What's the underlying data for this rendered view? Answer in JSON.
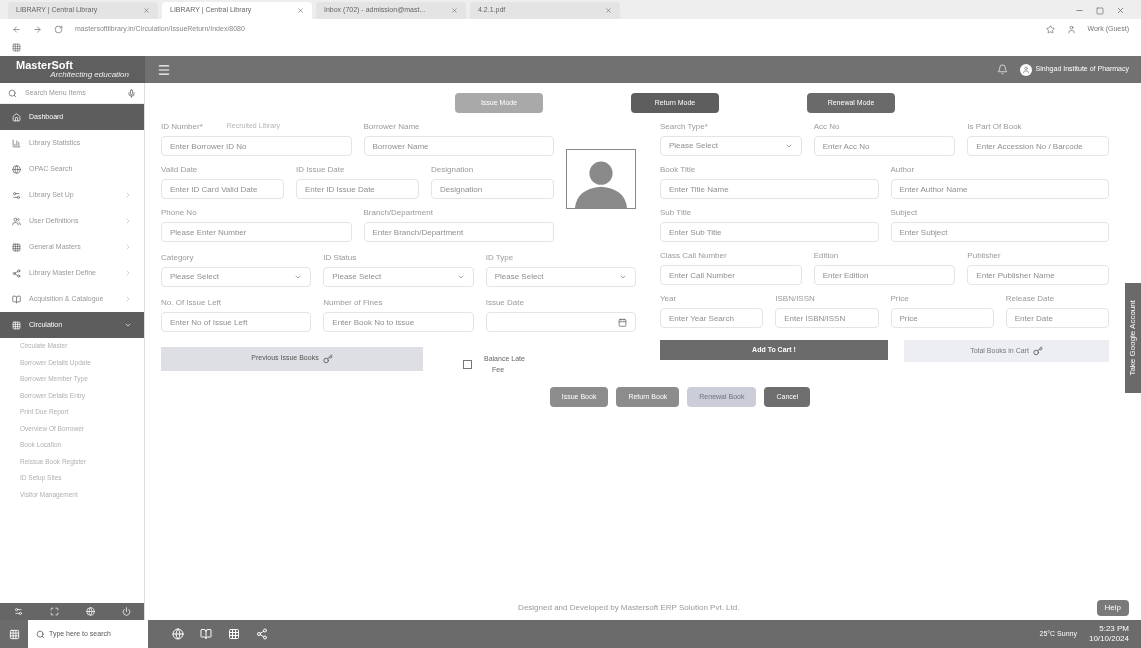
{
  "browser": {
    "tabs": [
      {
        "title": "LIBRARY | Central Library",
        "selected": false
      },
      {
        "title": "LIBRARY | Central Library",
        "selected": true
      },
      {
        "title": "Inbox (702) - admission@mast...",
        "selected": false
      },
      {
        "title": "4.2.1.pdf",
        "selected": false
      }
    ],
    "address": "mastersoftlibrary.in/Circulation/IssueReturn/Index/8080",
    "profile": "Work (Guest)"
  },
  "header": {
    "logo": "MasterSoft",
    "tagline": "Architecting education",
    "user": "Sinhgad Institute of Pharmacy"
  },
  "sidebar": {
    "search_placeholder": "Search Menu Items",
    "items": [
      {
        "label": "Dashboard",
        "selected": true,
        "expandable": false
      },
      {
        "label": "Library Statistics",
        "selected": false,
        "expandable": false
      },
      {
        "label": "OPAC Search",
        "selected": false,
        "expandable": false
      },
      {
        "label": "Library Set Up",
        "selected": false,
        "expandable": true
      },
      {
        "label": "User Definitions",
        "selected": false,
        "expandable": true
      },
      {
        "label": "General Masters",
        "selected": false,
        "expandable": true
      },
      {
        "label": "Library Master Define",
        "selected": false,
        "expandable": true
      },
      {
        "label": "Acquisition & Catalogue",
        "selected": false,
        "expandable": true
      },
      {
        "label": "Circulation",
        "selected": true,
        "expandable": true,
        "children": [
          {
            "label": "Circulate Master"
          },
          {
            "label": "Borrower Details Update"
          },
          {
            "label": "Borrower Member Type"
          },
          {
            "label": "Borrower Details Entry"
          },
          {
            "label": "Print Due Report"
          },
          {
            "label": "Overview Of Borrower"
          },
          {
            "label": "Book Location"
          },
          {
            "label": "Reissue Book Register"
          },
          {
            "label": "ID Setup Sites"
          },
          {
            "label": "Visitor Management"
          }
        ]
      }
    ]
  },
  "modes": [
    {
      "label": "Issue Mode",
      "selected": true
    },
    {
      "label": "Return Mode",
      "selected": false
    },
    {
      "label": "Renewal Mode",
      "selected": false
    }
  ],
  "borrower_rows": [
    [
      {
        "label": "ID Number*",
        "note": "Recruited Library",
        "placeholder": "Enter Borrower ID No",
        "kind": "text"
      },
      {
        "label": "Borrower Name",
        "placeholder": "Borrower Name",
        "kind": "text"
      }
    ],
    [
      {
        "label": "Valid Date",
        "placeholder": "Enter ID Card Valid Date",
        "kind": "text"
      },
      {
        "label": "ID Issue Date",
        "placeholder": "Enter ID Issue Date",
        "kind": "text"
      },
      {
        "label": "Designation",
        "placeholder": "Designation",
        "kind": "text"
      }
    ],
    [
      {
        "label": "Phone No",
        "placeholder": "Please Enter Number",
        "kind": "text"
      },
      {
        "label": "Branch/Department",
        "placeholder": "Enter Branch/Department",
        "kind": "text"
      }
    ]
  ],
  "lower_rows": [
    [
      {
        "label": "Category",
        "placeholder": "Please Select",
        "kind": "select"
      },
      {
        "label": "ID Status",
        "placeholder": "Please Select",
        "kind": "select"
      },
      {
        "label": "ID Type",
        "placeholder": "Please Select",
        "kind": "select"
      }
    ],
    [
      {
        "label": "No. Of Issue Left",
        "placeholder": "Enter No of Issue Left",
        "kind": "text"
      },
      {
        "label": "Number of Fines",
        "placeholder": "Enter Book No to issue",
        "kind": "text"
      },
      {
        "label": "Issue Date",
        "kind": "date"
      }
    ]
  ],
  "previous_issue": "Previous Issue Books",
  "late_fee": {
    "label": "Balance Late",
    "sub": "Fee",
    "checked": false
  },
  "book_rows": [
    [
      {
        "label": "Search Type*",
        "placeholder": "Please Select",
        "kind": "select"
      },
      {
        "label": "Acc No",
        "placeholder": "Enter Acc No",
        "kind": "text"
      },
      {
        "label": "Is Part Of Book",
        "placeholder": "Enter Accession No / Barcode",
        "kind": "text"
      }
    ],
    [
      {
        "label": "Book Title",
        "placeholder": "Enter Title Name",
        "kind": "text"
      },
      {
        "label": "Author",
        "placeholder": "Enter Author Name",
        "kind": "text"
      }
    ],
    [
      {
        "label": "Sub Title",
        "placeholder": "Enter Sub Title",
        "kind": "text"
      },
      {
        "label": "Subject",
        "placeholder": "Enter Subject",
        "kind": "text"
      }
    ],
    [
      {
        "label": "Class Call Number",
        "placeholder": "Enter Call Number",
        "kind": "text"
      },
      {
        "label": "Edition",
        "placeholder": "Enter Edition",
        "kind": "text"
      },
      {
        "label": "Publisher",
        "placeholder": "Enter Publisher Name",
        "kind": "text"
      }
    ],
    [
      {
        "label": "Year",
        "placeholder": "Enter Year Search",
        "kind": "text"
      },
      {
        "label": "ISBN/ISSN",
        "placeholder": "Enter ISBN/ISSN",
        "kind": "text"
      },
      {
        "label": "Price",
        "placeholder": "Price",
        "kind": "text"
      },
      {
        "label": "Release Date",
        "placeholder": "Enter Date",
        "kind": "text"
      }
    ]
  ],
  "add_to_cart": "Add To Cart !",
  "cart_total": "Total Books in Cart",
  "actions": [
    {
      "label": "Issue Book",
      "disabled": false
    },
    {
      "label": "Return Book",
      "disabled": false
    },
    {
      "label": "Renewal Book",
      "disabled": true
    },
    {
      "label": "Cancel",
      "disabled": false
    }
  ],
  "side_tab": "Take Google Account",
  "help": "Help",
  "footer": "Designed and Developed by Mastersoft ERP Solution Pvt. Ltd.",
  "taskbar": {
    "search_placeholder": "Type here to search",
    "weather": "25°C Sunny",
    "time": "5:23 PM",
    "date": "10/10/2024"
  }
}
